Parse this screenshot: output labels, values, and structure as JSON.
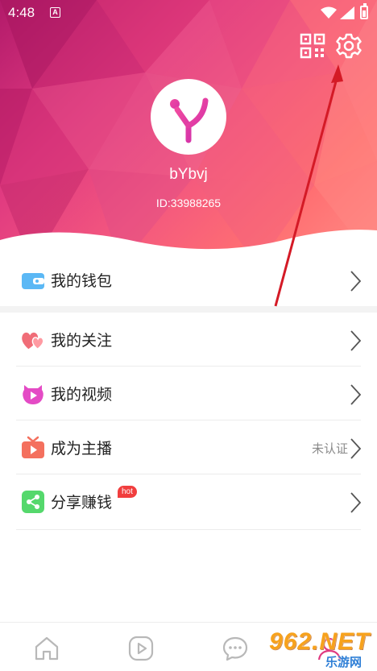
{
  "status_bar": {
    "time": "4:48",
    "badge": "A"
  },
  "header": {
    "qr_icon": "qr-code-icon",
    "settings_icon": "gear-icon"
  },
  "profile": {
    "username": "bYbvj",
    "user_id": "ID:33988265"
  },
  "menu": [
    {
      "label": "我的钱包",
      "icon": "wallet-icon",
      "color": "#5bb8f5"
    },
    {
      "label": "我的关注",
      "icon": "hearts-icon",
      "color": "#f06d78"
    },
    {
      "label": "我的视频",
      "icon": "video-play-icon",
      "color": "#e44bc5"
    },
    {
      "label": "成为主播",
      "icon": "tv-icon",
      "color": "#f4705e",
      "status": "未认证"
    },
    {
      "label": "分享赚钱",
      "icon": "share-icon",
      "color": "#55d86c",
      "badge": "hot"
    }
  ],
  "bottom_nav": [
    {
      "icon": "home-icon"
    },
    {
      "icon": "play-icon"
    },
    {
      "icon": "chat-icon"
    },
    {
      "icon": "profile-icon"
    }
  ],
  "watermark": {
    "main": "962.NET",
    "sub": "乐游网"
  },
  "colors": {
    "accent": "#e03a80",
    "text": "#222222",
    "muted": "#8a8a8a"
  }
}
